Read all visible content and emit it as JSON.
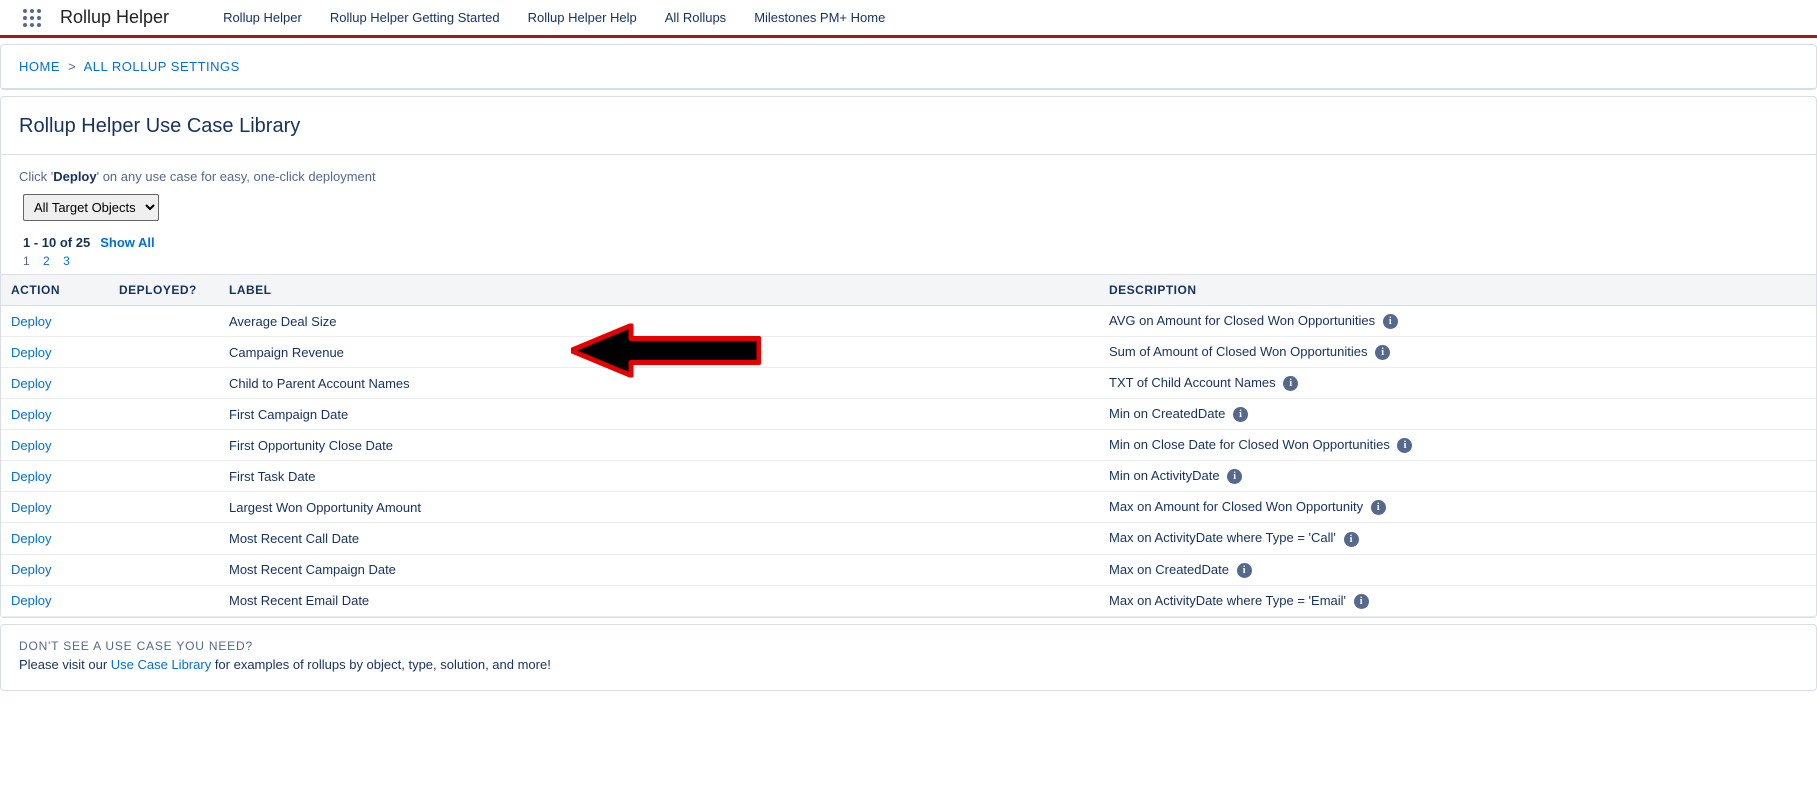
{
  "header": {
    "app_name": "Rollup Helper",
    "tabs": [
      "Rollup Helper",
      "Rollup Helper Getting Started",
      "Rollup Helper Help",
      "All Rollups",
      "Milestones PM+ Home"
    ]
  },
  "breadcrumbs": {
    "home": "HOME",
    "current": "ALL ROLLUP SETTINGS"
  },
  "page_title": "Rollup Helper Use Case Library",
  "instructions": {
    "prefix": "Click '",
    "bold": "Deploy",
    "suffix": "' on any use case for easy, one-click deployment"
  },
  "filter": {
    "selected": "All Target Objects"
  },
  "pager": {
    "range_prefix": "1 - 10 of ",
    "total": "25",
    "show_all": "Show All",
    "pages": [
      "1",
      "2",
      "3"
    ]
  },
  "columns": {
    "action": "ACTION",
    "deployed": "DEPLOYED?",
    "label": "LABEL",
    "description": "DESCRIPTION"
  },
  "deploy_label": "Deploy",
  "rows": [
    {
      "label": "Average Deal Size",
      "description": "AVG on Amount for Closed Won Opportunities",
      "highlight": false
    },
    {
      "label": "Campaign Revenue",
      "description": "Sum of Amount of Closed Won Opportunities",
      "highlight": true
    },
    {
      "label": "Child to Parent Account Names",
      "description": "TXT of Child Account Names",
      "highlight": false
    },
    {
      "label": "First Campaign Date",
      "description": "Min on CreatedDate",
      "highlight": false
    },
    {
      "label": "First Opportunity Close Date",
      "description": "Min on Close Date for Closed Won Opportunities",
      "highlight": false
    },
    {
      "label": "First Task Date",
      "description": "Min on ActivityDate",
      "highlight": false
    },
    {
      "label": "Largest Won Opportunity Amount",
      "description": "Max on Amount for Closed Won Opportunity",
      "highlight": false
    },
    {
      "label": "Most Recent Call Date",
      "description": "Max on ActivityDate where Type = 'Call'",
      "highlight": false
    },
    {
      "label": "Most Recent Campaign Date",
      "description": "Max on CreatedDate",
      "highlight": false
    },
    {
      "label": "Most Recent Email Date",
      "description": "Max on ActivityDate where Type = 'Email'",
      "highlight": false
    }
  ],
  "footer": {
    "heading": "DON'T SEE A USE CASE YOU NEED?",
    "text_before": "Please visit our ",
    "link": "Use Case Library",
    "text_after": " for examples of rollups by object, type, solution, and more!"
  }
}
